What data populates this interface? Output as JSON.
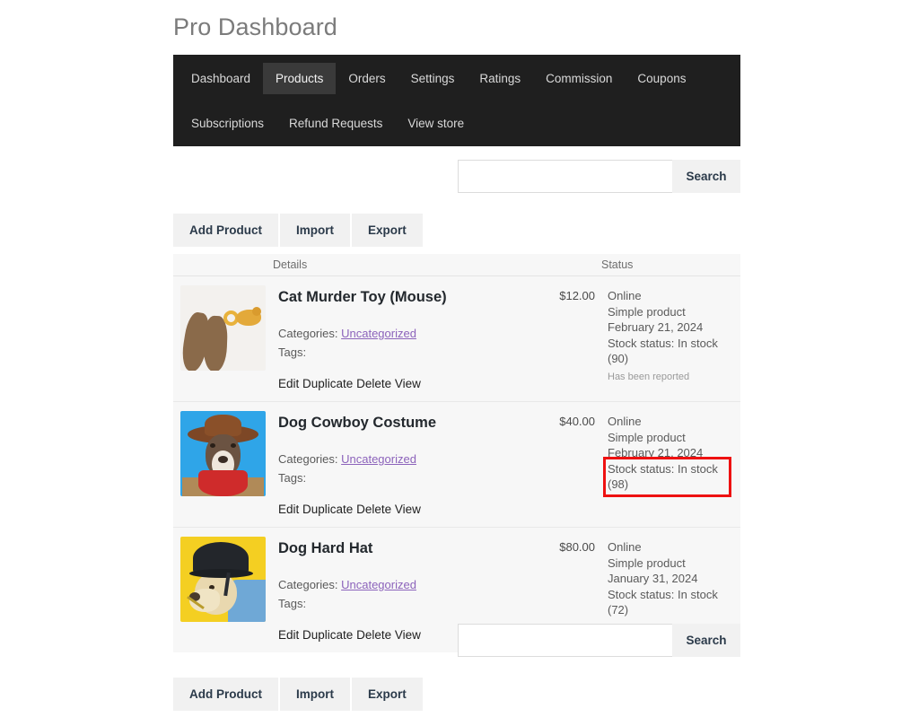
{
  "page": {
    "title": "Pro Dashboard"
  },
  "nav": {
    "row1": [
      {
        "label": "Dashboard",
        "active": false
      },
      {
        "label": "Products",
        "active": true
      },
      {
        "label": "Orders",
        "active": false
      },
      {
        "label": "Settings",
        "active": false
      },
      {
        "label": "Ratings",
        "active": false
      },
      {
        "label": "Commission",
        "active": false
      },
      {
        "label": "Coupons",
        "active": false
      }
    ],
    "row2": [
      {
        "label": "Subscriptions",
        "active": false
      },
      {
        "label": "Refund Requests",
        "active": false
      },
      {
        "label": "View store",
        "active": false
      }
    ]
  },
  "search": {
    "value": "",
    "placeholder": "",
    "button_label": "Search"
  },
  "toolbar": {
    "add_product_label": "Add Product",
    "import_label": "Import",
    "export_label": "Export"
  },
  "table": {
    "headers": {
      "details": "Details",
      "status": "Status"
    },
    "labels": {
      "categories": "Categories:",
      "tags": "Tags:",
      "edit": "Edit",
      "duplicate": "Duplicate",
      "delete": "Delete",
      "view": "View"
    },
    "rows": [
      {
        "title": "Cat Murder Toy (Mouse)",
        "price": "$12.00",
        "category": "Uncategorized",
        "tags": "",
        "visibility": "Online",
        "product_type": "Simple product",
        "date": "February 21, 2024",
        "stock": "Stock status: In stock (90)",
        "reported": "Has been reported",
        "highlighted": false,
        "thumb": "cat-toy-thumbnail"
      },
      {
        "title": "Dog Cowboy Costume",
        "price": "$40.00",
        "category": "Uncategorized",
        "tags": "",
        "visibility": "Online",
        "product_type": "Simple product",
        "date": "February 21, 2024",
        "stock": "Stock status: In stock (98)",
        "reported": "",
        "highlighted": true,
        "thumb": "dog-cowboy-thumbnail"
      },
      {
        "title": "Dog Hard Hat",
        "price": "$80.00",
        "category": "Uncategorized",
        "tags": "",
        "visibility": "Online",
        "product_type": "Simple product",
        "date": "January 31, 2024",
        "stock": "Stock status: In stock (72)",
        "reported": "",
        "highlighted": false,
        "thumb": "dog-hardhat-thumbnail"
      }
    ]
  },
  "colors": {
    "nav_background": "#1f1f1f",
    "nav_active": "#3a3a3a",
    "highlight_box": "#ee1111",
    "link": "#8c63bb",
    "button_face": "#f1f1f1",
    "table_background": "#f7f7f7"
  }
}
